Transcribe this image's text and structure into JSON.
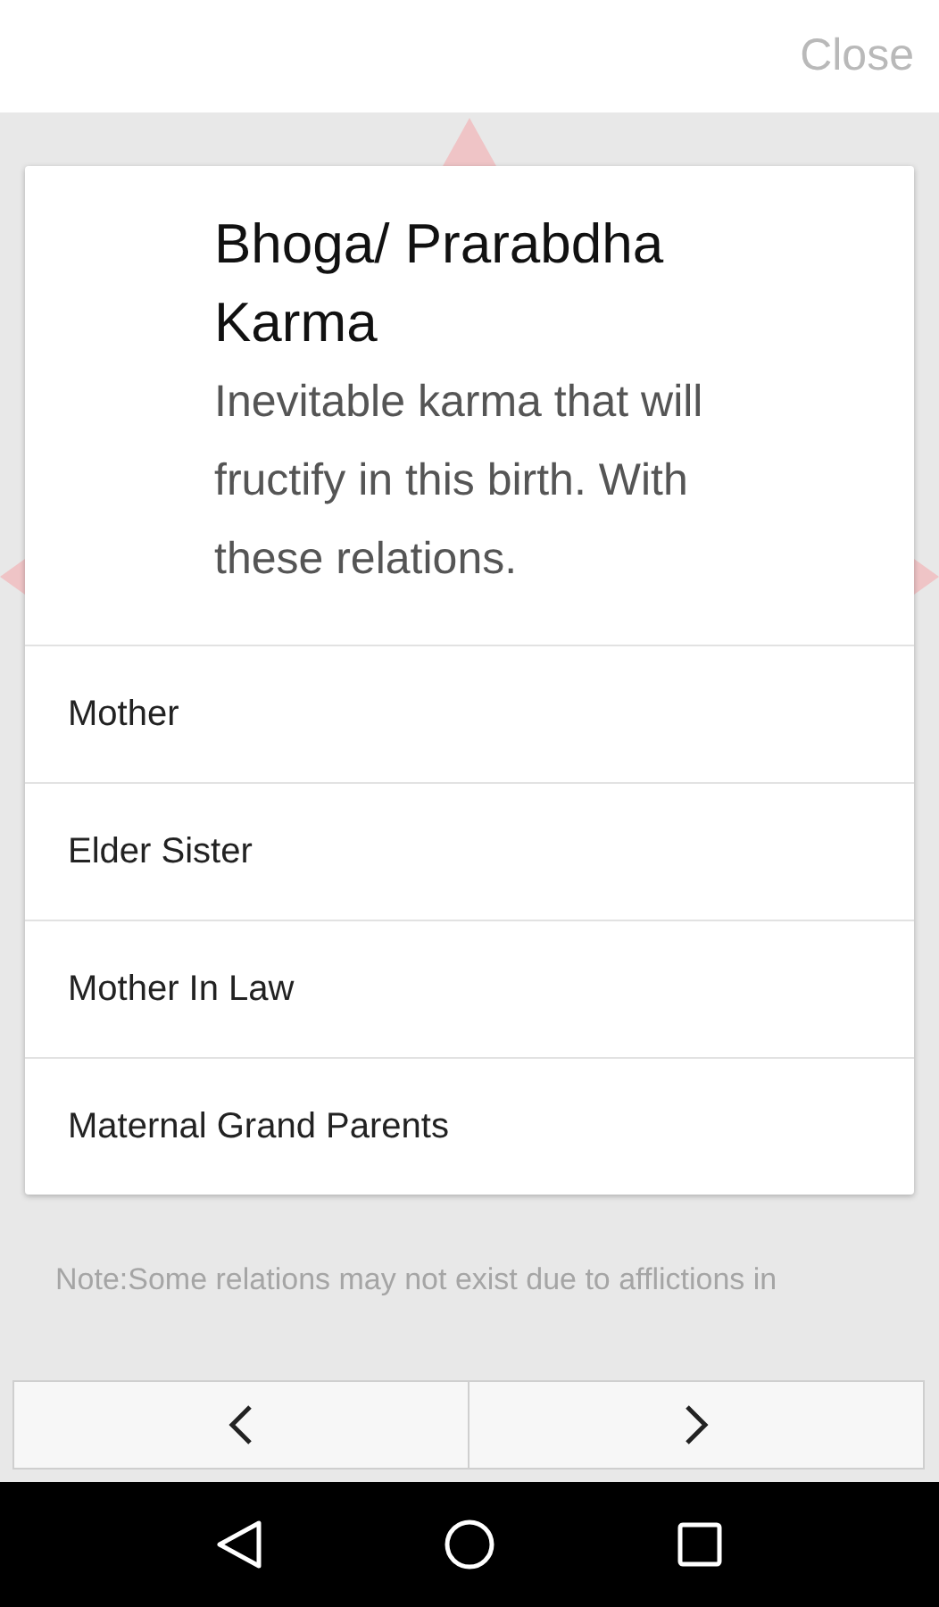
{
  "top_bar": {
    "close_label": "Close"
  },
  "card": {
    "title": "Bhoga/ Prarabdha Karma",
    "description": "Inevitable karma that will fructify in this birth. With these relations.",
    "relations": [
      "Mother",
      "Elder Sister",
      "Mother In Law",
      "Maternal Grand Parents"
    ]
  },
  "note": "Note:Some relations may not exist due to afflictions in"
}
